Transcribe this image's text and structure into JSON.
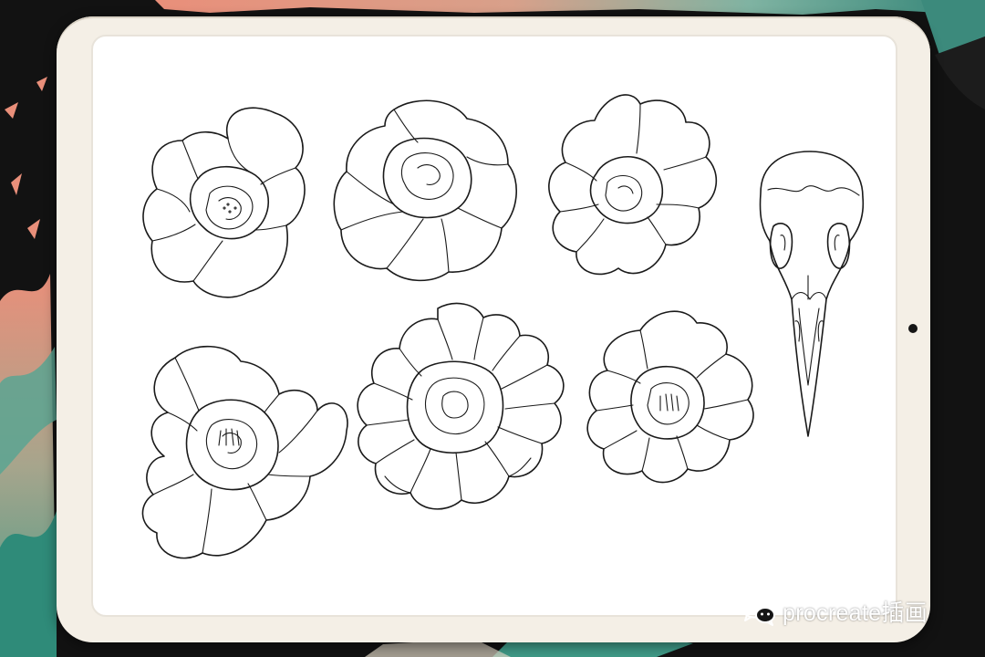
{
  "watermark": {
    "text": "procreate插画",
    "icon": "wechat-icon"
  },
  "canvas": {
    "drawings": [
      {
        "subject": "peony-bloom"
      },
      {
        "subject": "rose-bloom"
      },
      {
        "subject": "peony-bloom"
      },
      {
        "subject": "bird-skull"
      },
      {
        "subject": "peony-bloom"
      },
      {
        "subject": "chrysanthemum-bloom"
      },
      {
        "subject": "peony-bloom"
      }
    ]
  },
  "colors": {
    "tablet_frame": "#f4efe6",
    "screen": "#ffffff",
    "line_art": "#1a1a1a",
    "background_dark": "#111111",
    "accent_teal": "#4c9a8a",
    "accent_coral": "#e98f7a"
  }
}
